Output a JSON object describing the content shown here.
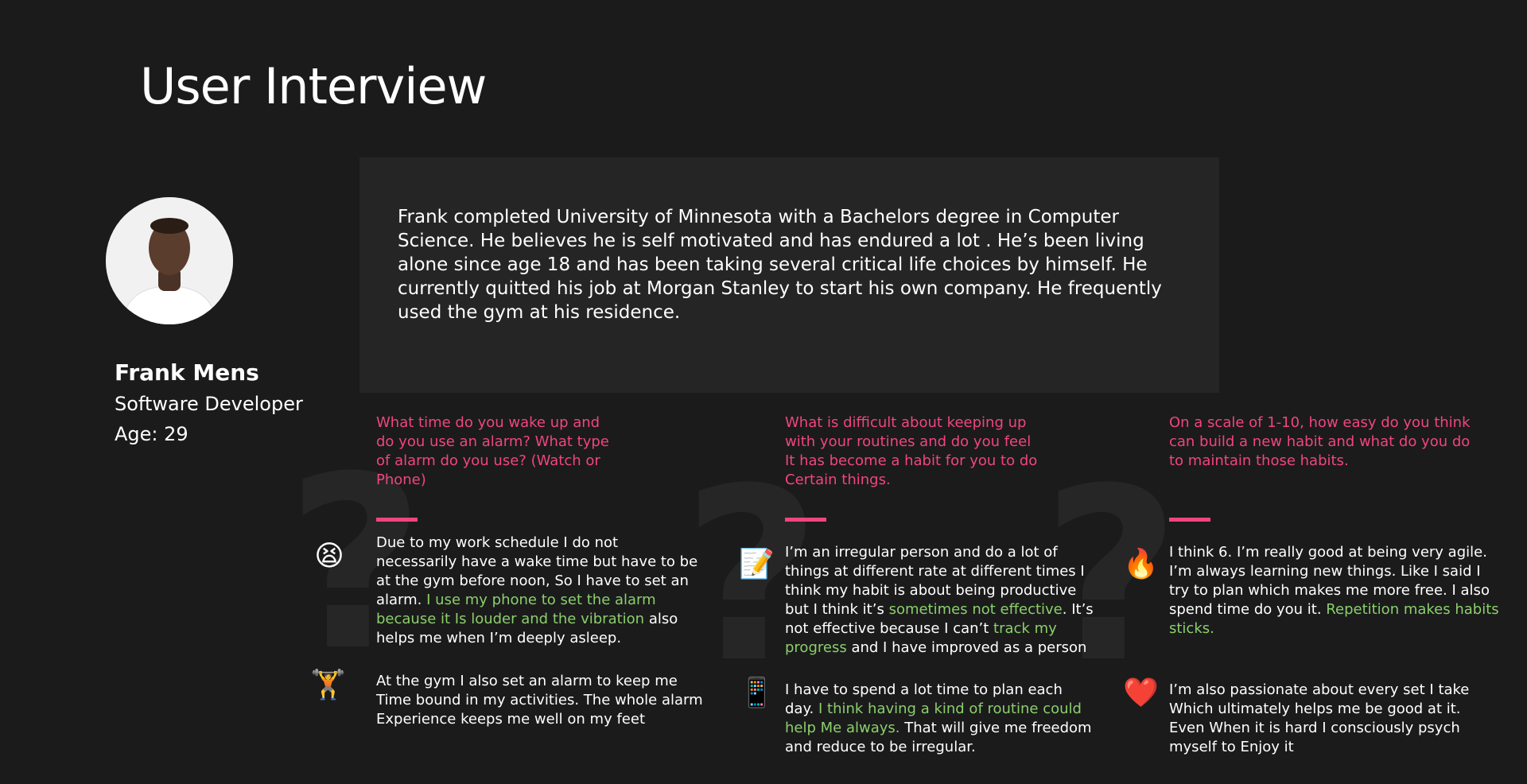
{
  "page": {
    "title": "User Interview"
  },
  "profile": {
    "name": "Frank Mens",
    "role": "Software Developer",
    "age": "Age: 29"
  },
  "bio": "Frank completed University of Minnesota with a Bachelors degree  in Computer Science. He believes he is self motivated and has endured a lot . He’s been living alone since age 18 and has been taking several critical life choices by himself. He currently quitted his job at Morgan Stanley to start his own company. He frequently used the gym at his residence.",
  "columns": [
    {
      "question": "What time do you wake up and do you use an alarm? What type of alarm do you use? (Watch or Phone)",
      "answers": [
        {
          "icon": "tired-face-icon",
          "glyph": "😫",
          "text_1": "Due to my work schedule I do not necessarily have a wake time but have to be at the gym before noon, So I have to set an alarm.",
          "highlight": "I use my phone to set the alarm because it Is louder and the vibration",
          "text_2": "also helps me when I’m deeply asleep."
        },
        {
          "icon": "weightlifter-icon",
          "glyph": "🏋️",
          "text_1": "At the gym I also set an alarm to keep me Time bound in my activities. The whole alarm Experience keeps me well on my feet",
          "highlight": "",
          "text_2": ""
        }
      ]
    },
    {
      "question": "What is difficult about keeping up with your routines and do you feel It has become a habit for you to do Certain things.",
      "answers": [
        {
          "icon": "memo-icon",
          "glyph": "📝",
          "text_1": "I’m an irregular person and do a lot of things at different rate at different times I think my habit is about being productive but I think it’s",
          "highlight": "sometimes not effective",
          "text_2": ". It’s not effective because I can’t",
          "highlight_2": "track my progress",
          "text_3": "and I have improved as a person"
        },
        {
          "icon": "mobile-phone-icon",
          "glyph": "📱",
          "text_1": "I have to spend a lot time to plan each day.",
          "highlight": "I think having a kind of routine could help Me always.",
          "text_2": "That will give me freedom and reduce to be irregular."
        }
      ]
    },
    {
      "question": "On a scale of 1-10, how easy do you think can build a new habit and what do you do to maintain those habits.",
      "answers": [
        {
          "icon": "fire-icon",
          "glyph": "🔥",
          "text_1": "I think 6. I’m really good at being very agile. I’m always learning new things. Like I said I try to plan which makes me more free. I also spend time do you it.",
          "highlight": "Repetition makes habits sticks.",
          "text_2": ""
        },
        {
          "icon": "red-heart-icon",
          "glyph": "❤️",
          "text_1": "I’m also passionate about every set I take Which ultimately helps me be good at it. Even When it is hard I consciously psych myself to Enjoy it",
          "highlight": "",
          "text_2": ""
        }
      ]
    }
  ],
  "colors": {
    "background": "#1b1b1c",
    "card": "#252526",
    "question": "#f0457f",
    "highlight": "#8bcf6a"
  }
}
